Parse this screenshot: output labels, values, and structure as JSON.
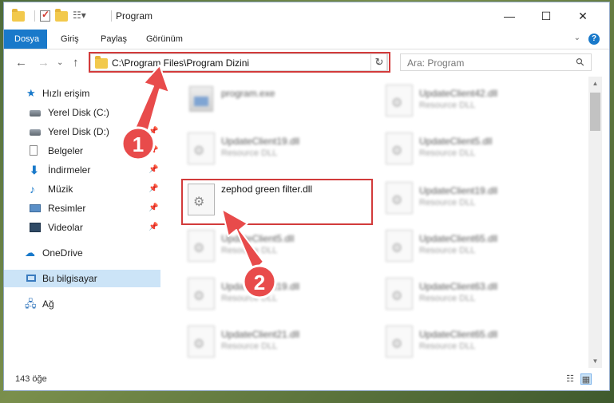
{
  "window": {
    "title": "Program",
    "controls": {
      "minimize": "—",
      "maximize": "☐",
      "close": "✕"
    }
  },
  "ribbon": {
    "tabs": [
      "Dosya",
      "Giriş",
      "Paylaş",
      "Görünüm"
    ],
    "help": "?"
  },
  "address_bar": {
    "path": "C:\\Program Files\\Program Dizini",
    "search_placeholder": "Ara: Program"
  },
  "nav_pane": {
    "quick_access": "Hızlı erişim",
    "items": [
      {
        "label": "Yerel Disk (C:)",
        "icon": "disk-icon",
        "pinned": false
      },
      {
        "label": "Yerel Disk (D:)",
        "icon": "disk-icon",
        "pinned": true
      },
      {
        "label": "Belgeler",
        "icon": "document-icon",
        "pinned": true
      },
      {
        "label": "İndirmeler",
        "icon": "download-icon",
        "pinned": true
      },
      {
        "label": "Müzik",
        "icon": "music-icon",
        "pinned": true
      },
      {
        "label": "Resimler",
        "icon": "pictures-icon",
        "pinned": true
      },
      {
        "label": "Videolar",
        "icon": "videos-icon",
        "pinned": true
      }
    ],
    "onedrive": "OneDrive",
    "this_pc": "Bu bilgisayar",
    "network": "Ağ"
  },
  "files": {
    "left_column": [
      {
        "name": "program.exe",
        "desc": ""
      },
      {
        "name": "UpdateClient19.dll",
        "desc": "Resource DLL"
      },
      {
        "name": "zephod green filter.dll",
        "desc": ""
      },
      {
        "name": "UpdateClient5.dll",
        "desc": "Resource DLL"
      },
      {
        "name": "UpdateClient19.dll",
        "desc": "Resource DLL"
      },
      {
        "name": "UpdateClient21.dll",
        "desc": "Resource DLL"
      }
    ],
    "right_column": [
      {
        "name": "UpdateClient42.dll",
        "desc": "Resource DLL"
      },
      {
        "name": "UpdateClient5.dll",
        "desc": "Resource DLL"
      },
      {
        "name": "UpdateClient19.dll",
        "desc": "Resource DLL"
      },
      {
        "name": "UpdateClient65.dll",
        "desc": "Resource DLL"
      },
      {
        "name": "UpdateClient63.dll",
        "desc": "Resource DLL"
      },
      {
        "name": "UpdateClient65.dll",
        "desc": "Resource DLL"
      }
    ]
  },
  "status": {
    "item_count": "143 öğe"
  },
  "annotations": {
    "step1": "1",
    "step2": "2",
    "highlight_color": "#d23b3b"
  },
  "colors": {
    "accent": "#1979ca",
    "selected": "#cce4f7"
  }
}
